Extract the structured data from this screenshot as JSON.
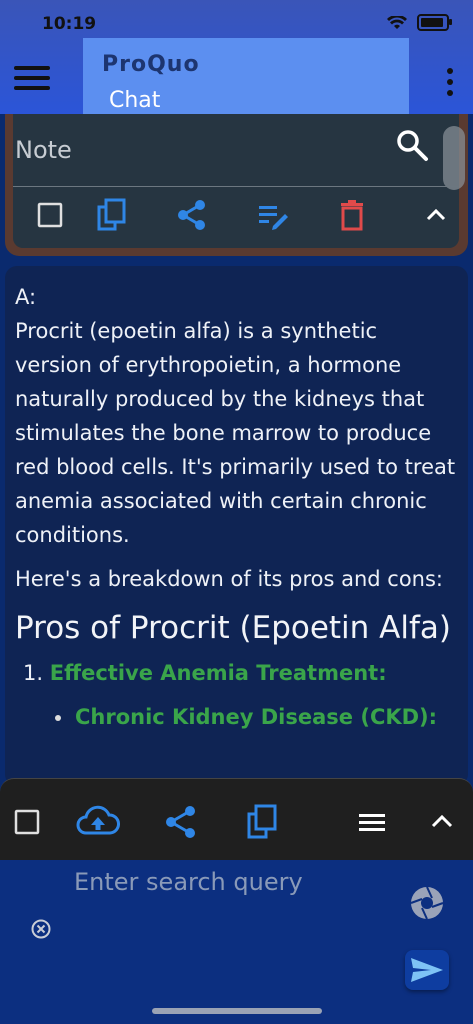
{
  "status": {
    "time": "10:19"
  },
  "header": {
    "app_name": "ProQuo",
    "subtitle": "Chat"
  },
  "note": {
    "label": "Note"
  },
  "chat": {
    "prefix": "A:",
    "para1": "Procrit (epoetin alfa) is a synthetic version of erythropoietin, a hormone naturally produced by the kidneys that stimulates the bone marrow to produce red blood cells. It's primarily used to treat anemia associated with certain chronic conditions.",
    "para2": "Here's a breakdown of its pros and cons:",
    "heading": "Pros of Procrit (Epoetin Alfa)",
    "item1_num": "1.",
    "item1_title": "Effective Anemia Treatment:",
    "bullet1": "Chronic Kidney Disease (CKD):"
  },
  "input": {
    "placeholder": "Enter search query"
  },
  "colors": {
    "accent_blue": "#2f86e6",
    "delete_red": "#e04a4a",
    "green_text": "#3aa54a"
  },
  "icons": {
    "note_toolbar": [
      "checkbox-icon",
      "copy-icon",
      "share-icon",
      "edit-list-icon",
      "delete-icon",
      "chevron-up-icon"
    ],
    "bottom_toolbar": [
      "checkbox-icon",
      "cloud-upload-icon",
      "share-icon",
      "copy-icon",
      "menu-icon",
      "chevron-up-icon"
    ]
  }
}
